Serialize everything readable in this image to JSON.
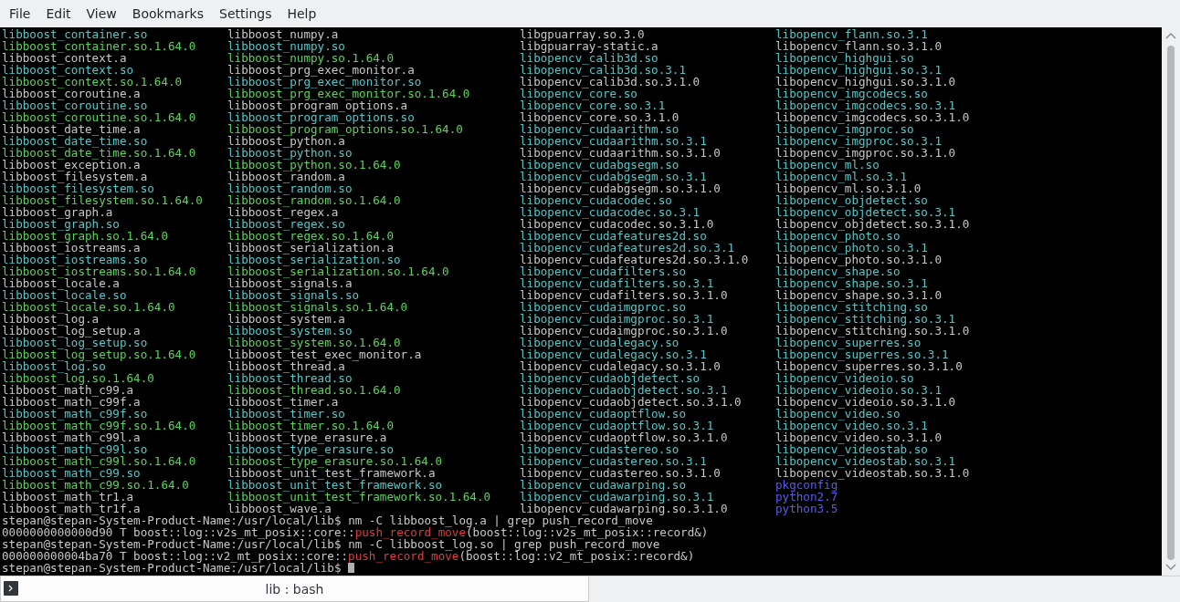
{
  "menu": [
    "File",
    "Edit",
    "View",
    "Bookmarks",
    "Settings",
    "Help"
  ],
  "listing": {
    "columns": [
      [
        {
          "name": "libboost_container.so",
          "kind": "link"
        },
        {
          "name": "libboost_container.so.1.64.0",
          "kind": "exec"
        },
        {
          "name": "libboost_context.a",
          "kind": "plain"
        },
        {
          "name": "libboost_context.so",
          "kind": "link"
        },
        {
          "name": "libboost_context.so.1.64.0",
          "kind": "exec"
        },
        {
          "name": "libboost_coroutine.a",
          "kind": "plain"
        },
        {
          "name": "libboost_coroutine.so",
          "kind": "link"
        },
        {
          "name": "libboost_coroutine.so.1.64.0",
          "kind": "exec"
        },
        {
          "name": "libboost_date_time.a",
          "kind": "plain"
        },
        {
          "name": "libboost_date_time.so",
          "kind": "link"
        },
        {
          "name": "libboost_date_time.so.1.64.0",
          "kind": "exec"
        },
        {
          "name": "libboost_exception.a",
          "kind": "plain"
        },
        {
          "name": "libboost_filesystem.a",
          "kind": "plain"
        },
        {
          "name": "libboost_filesystem.so",
          "kind": "link"
        },
        {
          "name": "libboost_filesystem.so.1.64.0",
          "kind": "exec"
        },
        {
          "name": "libboost_graph.a",
          "kind": "plain"
        },
        {
          "name": "libboost_graph.so",
          "kind": "link"
        },
        {
          "name": "libboost_graph.so.1.64.0",
          "kind": "exec"
        },
        {
          "name": "libboost_iostreams.a",
          "kind": "plain"
        },
        {
          "name": "libboost_iostreams.so",
          "kind": "link"
        },
        {
          "name": "libboost_iostreams.so.1.64.0",
          "kind": "exec"
        },
        {
          "name": "libboost_locale.a",
          "kind": "plain"
        },
        {
          "name": "libboost_locale.so",
          "kind": "link"
        },
        {
          "name": "libboost_locale.so.1.64.0",
          "kind": "exec"
        },
        {
          "name": "libboost_log.a",
          "kind": "plain"
        },
        {
          "name": "libboost_log_setup.a",
          "kind": "plain"
        },
        {
          "name": "libboost_log_setup.so",
          "kind": "link"
        },
        {
          "name": "libboost_log_setup.so.1.64.0",
          "kind": "exec"
        },
        {
          "name": "libboost_log.so",
          "kind": "link"
        },
        {
          "name": "libboost_log.so.1.64.0",
          "kind": "exec"
        },
        {
          "name": "libboost_math_c99.a",
          "kind": "plain"
        },
        {
          "name": "libboost_math_c99f.a",
          "kind": "plain"
        },
        {
          "name": "libboost_math_c99f.so",
          "kind": "link"
        },
        {
          "name": "libboost_math_c99f.so.1.64.0",
          "kind": "exec"
        },
        {
          "name": "libboost_math_c99l.a",
          "kind": "plain"
        },
        {
          "name": "libboost_math_c99l.so",
          "kind": "link"
        },
        {
          "name": "libboost_math_c99l.so.1.64.0",
          "kind": "exec"
        },
        {
          "name": "libboost_math_c99.so",
          "kind": "link"
        },
        {
          "name": "libboost_math_c99.so.1.64.0",
          "kind": "exec"
        },
        {
          "name": "libboost_math_tr1.a",
          "kind": "plain"
        },
        {
          "name": "libboost_math_tr1f.a",
          "kind": "plain"
        }
      ],
      [
        {
          "name": "libboost_numpy.a",
          "kind": "plain"
        },
        {
          "name": "libboost_numpy.so",
          "kind": "link"
        },
        {
          "name": "libboost_numpy.so.1.64.0",
          "kind": "exec"
        },
        {
          "name": "libboost_prg_exec_monitor.a",
          "kind": "plain"
        },
        {
          "name": "libboost_prg_exec_monitor.so",
          "kind": "link"
        },
        {
          "name": "libboost_prg_exec_monitor.so.1.64.0",
          "kind": "exec"
        },
        {
          "name": "libboost_program_options.a",
          "kind": "plain"
        },
        {
          "name": "libboost_program_options.so",
          "kind": "link"
        },
        {
          "name": "libboost_program_options.so.1.64.0",
          "kind": "exec"
        },
        {
          "name": "libboost_python.a",
          "kind": "plain"
        },
        {
          "name": "libboost_python.so",
          "kind": "link"
        },
        {
          "name": "libboost_python.so.1.64.0",
          "kind": "exec"
        },
        {
          "name": "libboost_random.a",
          "kind": "plain"
        },
        {
          "name": "libboost_random.so",
          "kind": "link"
        },
        {
          "name": "libboost_random.so.1.64.0",
          "kind": "exec"
        },
        {
          "name": "libboost_regex.a",
          "kind": "plain"
        },
        {
          "name": "libboost_regex.so",
          "kind": "link"
        },
        {
          "name": "libboost_regex.so.1.64.0",
          "kind": "exec"
        },
        {
          "name": "libboost_serialization.a",
          "kind": "plain"
        },
        {
          "name": "libboost_serialization.so",
          "kind": "link"
        },
        {
          "name": "libboost_serialization.so.1.64.0",
          "kind": "exec"
        },
        {
          "name": "libboost_signals.a",
          "kind": "plain"
        },
        {
          "name": "libboost_signals.so",
          "kind": "link"
        },
        {
          "name": "libboost_signals.so.1.64.0",
          "kind": "exec"
        },
        {
          "name": "libboost_system.a",
          "kind": "plain"
        },
        {
          "name": "libboost_system.so",
          "kind": "link"
        },
        {
          "name": "libboost_system.so.1.64.0",
          "kind": "exec"
        },
        {
          "name": "libboost_test_exec_monitor.a",
          "kind": "plain"
        },
        {
          "name": "libboost_thread.a",
          "kind": "plain"
        },
        {
          "name": "libboost_thread.so",
          "kind": "link"
        },
        {
          "name": "libboost_thread.so.1.64.0",
          "kind": "exec"
        },
        {
          "name": "libboost_timer.a",
          "kind": "plain"
        },
        {
          "name": "libboost_timer.so",
          "kind": "link"
        },
        {
          "name": "libboost_timer.so.1.64.0",
          "kind": "exec"
        },
        {
          "name": "libboost_type_erasure.a",
          "kind": "plain"
        },
        {
          "name": "libboost_type_erasure.so",
          "kind": "link"
        },
        {
          "name": "libboost_type_erasure.so.1.64.0",
          "kind": "exec"
        },
        {
          "name": "libboost_unit_test_framework.a",
          "kind": "plain"
        },
        {
          "name": "libboost_unit_test_framework.so",
          "kind": "link"
        },
        {
          "name": "libboost_unit_test_framework.so.1.64.0",
          "kind": "exec"
        },
        {
          "name": "libboost_wave.a",
          "kind": "plain"
        }
      ],
      [
        {
          "name": "libgpuarray.so.3.0",
          "kind": "plain"
        },
        {
          "name": "libgpuarray-static.a",
          "kind": "plain"
        },
        {
          "name": "libopencv_calib3d.so",
          "kind": "link"
        },
        {
          "name": "libopencv_calib3d.so.3.1",
          "kind": "link"
        },
        {
          "name": "libopencv_calib3d.so.3.1.0",
          "kind": "plain"
        },
        {
          "name": "libopencv_core.so",
          "kind": "link"
        },
        {
          "name": "libopencv_core.so.3.1",
          "kind": "link"
        },
        {
          "name": "libopencv_core.so.3.1.0",
          "kind": "plain"
        },
        {
          "name": "libopencv_cudaarithm.so",
          "kind": "link"
        },
        {
          "name": "libopencv_cudaarithm.so.3.1",
          "kind": "link"
        },
        {
          "name": "libopencv_cudaarithm.so.3.1.0",
          "kind": "plain"
        },
        {
          "name": "libopencv_cudabgsegm.so",
          "kind": "link"
        },
        {
          "name": "libopencv_cudabgsegm.so.3.1",
          "kind": "link"
        },
        {
          "name": "libopencv_cudabgsegm.so.3.1.0",
          "kind": "plain"
        },
        {
          "name": "libopencv_cudacodec.so",
          "kind": "link"
        },
        {
          "name": "libopencv_cudacodec.so.3.1",
          "kind": "link"
        },
        {
          "name": "libopencv_cudacodec.so.3.1.0",
          "kind": "plain"
        },
        {
          "name": "libopencv_cudafeatures2d.so",
          "kind": "link"
        },
        {
          "name": "libopencv_cudafeatures2d.so.3.1",
          "kind": "link"
        },
        {
          "name": "libopencv_cudafeatures2d.so.3.1.0",
          "kind": "plain"
        },
        {
          "name": "libopencv_cudafilters.so",
          "kind": "link"
        },
        {
          "name": "libopencv_cudafilters.so.3.1",
          "kind": "link"
        },
        {
          "name": "libopencv_cudafilters.so.3.1.0",
          "kind": "plain"
        },
        {
          "name": "libopencv_cudaimgproc.so",
          "kind": "link"
        },
        {
          "name": "libopencv_cudaimgproc.so.3.1",
          "kind": "link"
        },
        {
          "name": "libopencv_cudaimgproc.so.3.1.0",
          "kind": "plain"
        },
        {
          "name": "libopencv_cudalegacy.so",
          "kind": "link"
        },
        {
          "name": "libopencv_cudalegacy.so.3.1",
          "kind": "link"
        },
        {
          "name": "libopencv_cudalegacy.so.3.1.0",
          "kind": "plain"
        },
        {
          "name": "libopencv_cudaobjdetect.so",
          "kind": "link"
        },
        {
          "name": "libopencv_cudaobjdetect.so.3.1",
          "kind": "link"
        },
        {
          "name": "libopencv_cudaobjdetect.so.3.1.0",
          "kind": "plain"
        },
        {
          "name": "libopencv_cudaoptflow.so",
          "kind": "link"
        },
        {
          "name": "libopencv_cudaoptflow.so.3.1",
          "kind": "link"
        },
        {
          "name": "libopencv_cudaoptflow.so.3.1.0",
          "kind": "plain"
        },
        {
          "name": "libopencv_cudastereo.so",
          "kind": "link"
        },
        {
          "name": "libopencv_cudastereo.so.3.1",
          "kind": "link"
        },
        {
          "name": "libopencv_cudastereo.so.3.1.0",
          "kind": "plain"
        },
        {
          "name": "libopencv_cudawarping.so",
          "kind": "link"
        },
        {
          "name": "libopencv_cudawarping.so.3.1",
          "kind": "link"
        },
        {
          "name": "libopencv_cudawarping.so.3.1.0",
          "kind": "plain"
        }
      ],
      [
        {
          "name": "libopencv_flann.so.3.1",
          "kind": "link"
        },
        {
          "name": "libopencv_flann.so.3.1.0",
          "kind": "plain"
        },
        {
          "name": "libopencv_highgui.so",
          "kind": "link"
        },
        {
          "name": "libopencv_highgui.so.3.1",
          "kind": "link"
        },
        {
          "name": "libopencv_highgui.so.3.1.0",
          "kind": "plain"
        },
        {
          "name": "libopencv_imgcodecs.so",
          "kind": "link"
        },
        {
          "name": "libopencv_imgcodecs.so.3.1",
          "kind": "link"
        },
        {
          "name": "libopencv_imgcodecs.so.3.1.0",
          "kind": "plain"
        },
        {
          "name": "libopencv_imgproc.so",
          "kind": "link"
        },
        {
          "name": "libopencv_imgproc.so.3.1",
          "kind": "link"
        },
        {
          "name": "libopencv_imgproc.so.3.1.0",
          "kind": "plain"
        },
        {
          "name": "libopencv_ml.so",
          "kind": "link"
        },
        {
          "name": "libopencv_ml.so.3.1",
          "kind": "link"
        },
        {
          "name": "libopencv_ml.so.3.1.0",
          "kind": "plain"
        },
        {
          "name": "libopencv_objdetect.so",
          "kind": "link"
        },
        {
          "name": "libopencv_objdetect.so.3.1",
          "kind": "link"
        },
        {
          "name": "libopencv_objdetect.so.3.1.0",
          "kind": "plain"
        },
        {
          "name": "libopencv_photo.so",
          "kind": "link"
        },
        {
          "name": "libopencv_photo.so.3.1",
          "kind": "link"
        },
        {
          "name": "libopencv_photo.so.3.1.0",
          "kind": "plain"
        },
        {
          "name": "libopencv_shape.so",
          "kind": "link"
        },
        {
          "name": "libopencv_shape.so.3.1",
          "kind": "link"
        },
        {
          "name": "libopencv_shape.so.3.1.0",
          "kind": "plain"
        },
        {
          "name": "libopencv_stitching.so",
          "kind": "link"
        },
        {
          "name": "libopencv_stitching.so.3.1",
          "kind": "link"
        },
        {
          "name": "libopencv_stitching.so.3.1.0",
          "kind": "plain"
        },
        {
          "name": "libopencv_superres.so",
          "kind": "link"
        },
        {
          "name": "libopencv_superres.so.3.1",
          "kind": "link"
        },
        {
          "name": "libopencv_superres.so.3.1.0",
          "kind": "plain"
        },
        {
          "name": "libopencv_videoio.so",
          "kind": "link"
        },
        {
          "name": "libopencv_videoio.so.3.1",
          "kind": "link"
        },
        {
          "name": "libopencv_videoio.so.3.1.0",
          "kind": "plain"
        },
        {
          "name": "libopencv_video.so",
          "kind": "link"
        },
        {
          "name": "libopencv_video.so.3.1",
          "kind": "link"
        },
        {
          "name": "libopencv_video.so.3.1.0",
          "kind": "plain"
        },
        {
          "name": "libopencv_videostab.so",
          "kind": "link"
        },
        {
          "name": "libopencv_videostab.so.3.1",
          "kind": "link"
        },
        {
          "name": "libopencv_videostab.so.3.1.0",
          "kind": "plain"
        },
        {
          "name": "pkgconfig",
          "kind": "dir"
        },
        {
          "name": "python2.7",
          "kind": "dir"
        },
        {
          "name": "python3.5",
          "kind": "dir"
        }
      ]
    ]
  },
  "session": [
    {
      "kind": "prompt",
      "prompt": "stepan@stepan-System-Product-Name:/usr/local/lib$",
      "command": "nm -C libboost_log.a | grep push_record_move"
    },
    {
      "kind": "output",
      "before": "0000000000000d90 T boost::log::v2s_mt_posix::core::",
      "match": "push_record_move",
      "after": "(boost::log::v2s_mt_posix::record&)"
    },
    {
      "kind": "prompt",
      "prompt": "stepan@stepan-System-Product-Name:/usr/local/lib$",
      "command": "nm -C libboost_log.so | grep push_record_move"
    },
    {
      "kind": "output",
      "before": "000000000004ba70 T boost::log::v2_mt_posix::core::",
      "match": "push_record_move",
      "after": "(boost::log::v2_mt_posix::record&)"
    },
    {
      "kind": "prompt",
      "prompt": "stepan@stepan-System-Product-Name:/usr/local/lib$",
      "cursor": true
    }
  ],
  "tab": {
    "label": "lib : bash"
  }
}
